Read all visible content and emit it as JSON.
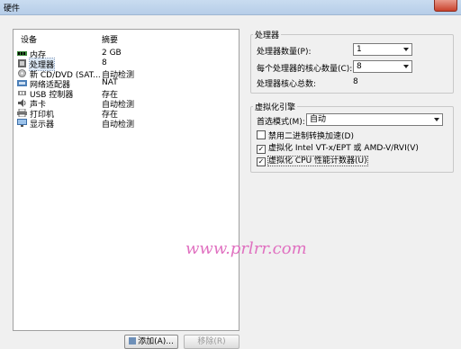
{
  "window": {
    "title": "硬件"
  },
  "device_list": {
    "col_device": "设备",
    "col_summary": "摘要",
    "items": [
      {
        "name": "内存",
        "summary": "2 GB",
        "icon": "memory-icon"
      },
      {
        "name": "处理器",
        "summary": "8",
        "icon": "processor-icon"
      },
      {
        "name": "新 CD/DVD (SAT...",
        "summary": "自动检测",
        "icon": "cd-dvd-icon"
      },
      {
        "name": "网络适配器",
        "summary": "NAT",
        "icon": "network-adapter-icon"
      },
      {
        "name": "USB 控制器",
        "summary": "存在",
        "icon": "usb-icon"
      },
      {
        "name": "声卡",
        "summary": "自动检测",
        "icon": "sound-card-icon"
      },
      {
        "name": "打印机",
        "summary": "存在",
        "icon": "printer-icon"
      },
      {
        "name": "显示器",
        "summary": "自动检测",
        "icon": "display-icon"
      }
    ],
    "selected_index": 1
  },
  "buttons": {
    "add": "添加(A)...",
    "remove": "移除(R)"
  },
  "processors": {
    "group_title": "处理器",
    "count_label": "处理器数量(P):",
    "count_value": "1",
    "cores_label": "每个处理器的核心数量(C):",
    "cores_value": "8",
    "total_label": "处理器核心总数:",
    "total_value": "8"
  },
  "virtualization": {
    "group_title": "虚拟化引擎",
    "mode_label": "首选模式(M):",
    "mode_value": "自动",
    "options": [
      {
        "label": "禁用二进制转换加速(D)",
        "checked": false
      },
      {
        "label": "虚拟化 Intel VT-x/EPT 或 AMD-V/RVI(V)",
        "checked": true
      },
      {
        "label": "虚拟化 CPU 性能计数器(U)",
        "checked": true
      }
    ]
  },
  "watermark": "www.prlrr.com",
  "colors": {
    "titlebar": "#b6cde8",
    "selection": "#dce8f5",
    "watermark": "#e070c0"
  }
}
